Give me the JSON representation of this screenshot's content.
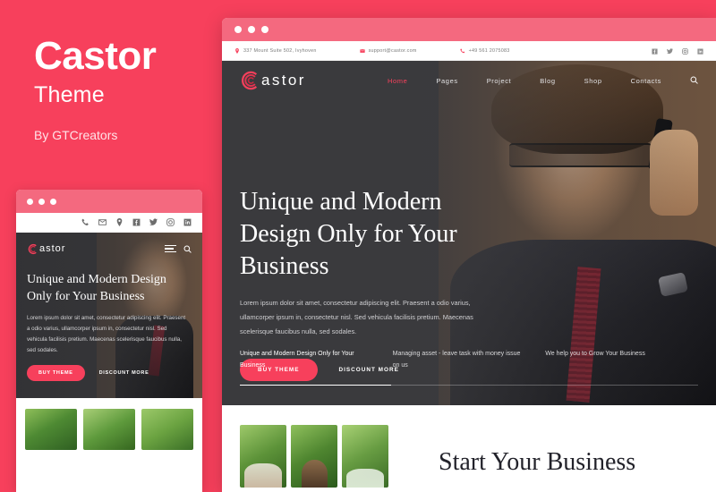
{
  "promo": {
    "title": "Castor",
    "subtitle": "Theme",
    "author": "By GTCreators"
  },
  "colors": {
    "brand_pink": "#f7405c",
    "titlebar_pink": "#f4697f",
    "hero_dark": "#3c3c3f",
    "heading_dark": "#22222a"
  },
  "browser_window": {
    "dots_count": 3
  },
  "site": {
    "contact_bar": {
      "address": "337 Mount Suite 502, Ivyhoven",
      "email": "support@castor.com",
      "phone": "+49 561 2075083",
      "social": [
        "facebook-icon",
        "twitter-icon",
        "instagram-icon",
        "linkedin-icon"
      ]
    },
    "header": {
      "logo_mark": "castor-c-icon",
      "logo_text": "astor",
      "nav": [
        {
          "label": "Home",
          "active": true
        },
        {
          "label": "Pages",
          "active": false
        },
        {
          "label": "Project",
          "active": false
        },
        {
          "label": "Blog",
          "active": false
        },
        {
          "label": "Shop",
          "active": false
        },
        {
          "label": "Contacts",
          "active": false
        }
      ],
      "search_icon": "search-icon"
    },
    "hero": {
      "heading_line1": "Unique and Modern",
      "heading_line2": "Design Only for Your",
      "heading_line3": "Business",
      "paragraph": "Lorem ipsum dolor sit amet, consectetur adipiscing elit. Praesent a odio varius, ullamcorper ipsum in, consectetur nisl. Sed vehicula facilisis pretium. Maecenas scelerisque faucibus nulla, sed sodales.",
      "primary_button": "BUY THEME",
      "secondary_button": "DISCOUNT MORE"
    },
    "features": [
      "Unique and Modern Design Only for Your Business",
      "Managing asset - leave task with money issue on us",
      "We help you to Grow Your Business"
    ],
    "slider_progress": "33%",
    "lower_section": {
      "heading": "Start Your Business",
      "gallery_count": 3
    }
  },
  "mobile_preview": {
    "titlebar_dots": 3,
    "icon_row": [
      "phone-icon",
      "mail-icon",
      "pin-icon",
      "facebook-icon",
      "twitter-icon",
      "instagram-icon",
      "linkedin-icon"
    ],
    "logo_text": "astor",
    "menu_icon": "hamburger-icon",
    "search_icon": "search-icon",
    "heading_line1": "Unique and Modern Design",
    "heading_line2": "Only for Your Business",
    "paragraph": "Lorem ipsum dolor sit amet, consectetur adipiscing elit. Praesent a odio varius, ullamcorper ipsum in, consectetur nisl. Sed vehicula facilisis pretium. Maecenas scelerisque faucibus nulla, sed sodales.",
    "primary_button": "BUY THEME",
    "secondary_button": "DISCOUNT MORE",
    "thumb_count": 3
  }
}
